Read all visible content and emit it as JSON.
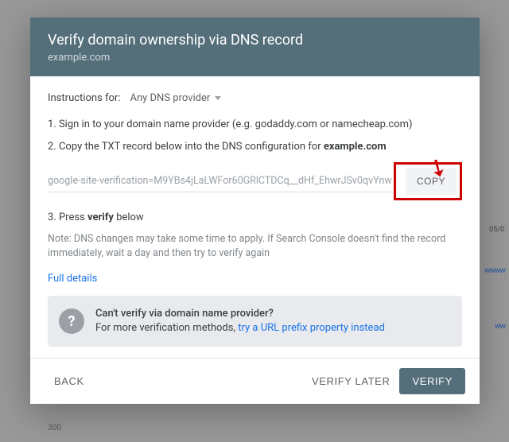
{
  "header": {
    "title": "Verify domain ownership via DNS record",
    "domain": "example.com"
  },
  "instructions": {
    "label": "Instructions for:",
    "provider": "Any DNS provider"
  },
  "steps": {
    "s1": "1. Sign in to your domain name provider (e.g. godaddy.com or namecheap.com)",
    "s2_prefix": "2. Copy the TXT record below into the DNS configuration for ",
    "s2_target": "example.com",
    "s3_prefix": "3. Press ",
    "s3_bold": "verify",
    "s3_suffix": " below"
  },
  "txt_record": "google-site-verification=M9YBs4jLaLWFor60GRlCTDCq__dHf_EhwrJSv0qvYnw",
  "copy_label": "COPY",
  "note": "Note: DNS changes may take some time to apply. If Search Console doesn't find the record immediately, wait a day and then try to verify again",
  "full_details": "Full details",
  "help": {
    "title": "Can't verify via domain name provider?",
    "text": "For more verification methods, ",
    "link": "try a URL prefix property instead"
  },
  "footer": {
    "back": "BACK",
    "later": "VERIFY LATER",
    "verify": "VERIFY"
  },
  "backdrop": {
    "date": "05/0",
    "num": "300"
  }
}
